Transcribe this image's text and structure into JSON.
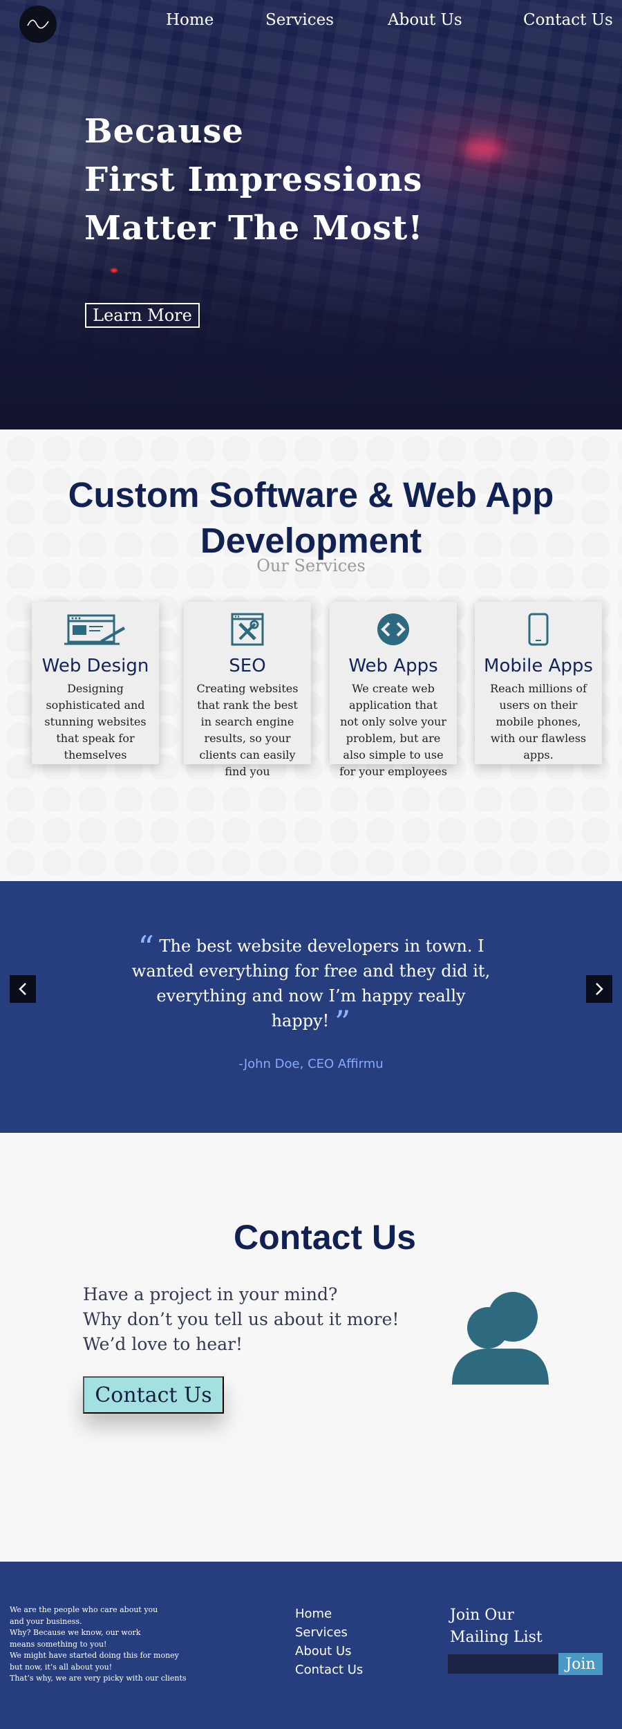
{
  "nav": {
    "logo_icon": "wave-logo-icon",
    "links": [
      "Home",
      "Services",
      "About Us",
      "Contact Us"
    ]
  },
  "hero": {
    "title_lines": [
      "Because",
      "First Impressions",
      "Matter The Most!"
    ],
    "button_label": "Learn More"
  },
  "services": {
    "heading_lines": [
      "Custom Software & Web App",
      "Development"
    ],
    "subheading": "Our Services",
    "cards": [
      {
        "icon": "browser-design-icon",
        "title": "Web Design",
        "description": "Designing sophisticated and stunning websites that speak for themselves"
      },
      {
        "icon": "tools-icon",
        "title": "SEO",
        "description": "Creating websites that rank the best in search engine results, so your clients can easily find you"
      },
      {
        "icon": "code-brackets-icon",
        "title": "Web Apps",
        "description": "We create web application that not only solve your problem, but are also simple to use for your employees"
      },
      {
        "icon": "smartphone-icon",
        "title": "Mobile Apps",
        "description": "Reach millions of users on their mobile phones, with our flawless apps."
      }
    ]
  },
  "testimonial": {
    "open_quote": "“",
    "close_quote": "”",
    "text": "The best website developers in town. I wanted everything for free and they did it, everything and now I’m happy really happy!",
    "author": "-John Doe, CEO Affirmu",
    "prev_icon": "chevron-left-icon",
    "next_icon": "chevron-right-icon"
  },
  "contact": {
    "title": "Contact Us",
    "lines": [
      "Have a project in your mind?",
      "Why don’t you tell us about it more!",
      "We’d love to hear!"
    ],
    "button_label": "Contact Us",
    "avatar_icon": "users-group-icon"
  },
  "footer": {
    "about_lines": [
      "We are the people who care about you",
      "and your business.",
      "Why? Because we know, our work",
      "means something to you!",
      "We might have started doing this for money",
      "but now, it’s all about you!",
      "That’s why, we are very picky with our clients"
    ],
    "links": [
      "Home",
      "Services",
      "About Us",
      "Contact Us"
    ],
    "mailing_title_lines": [
      "Join Our",
      "Mailing List"
    ],
    "mailing_placeholder": "",
    "join_label": "Join"
  },
  "colors": {
    "navy": "#112152",
    "band_blue": "#273e7e",
    "icon_teal": "#2e6a7f",
    "contact_button": "#a3e0e0",
    "join_button": "#4a98c4",
    "quote_accent": "#8fb4ff"
  }
}
